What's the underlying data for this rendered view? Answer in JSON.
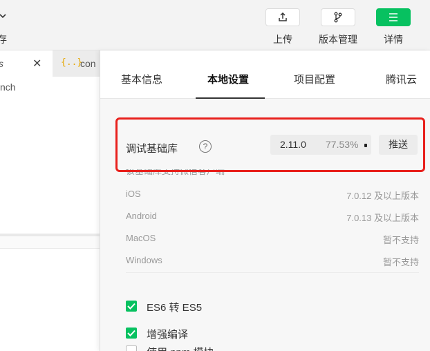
{
  "toolbar": {
    "left_partial_label": "存",
    "buttons": [
      {
        "label": "上传",
        "icon": "upload-icon"
      },
      {
        "label": "版本管理",
        "icon": "branch-icon"
      },
      {
        "label": "详情",
        "icon": "menu-icon"
      }
    ]
  },
  "editor": {
    "tabs": [
      {
        "label": "s",
        "active": true
      },
      {
        "label": "con",
        "icon": "{..}"
      }
    ],
    "partial_text": "nch"
  },
  "panel": {
    "tabs": [
      "基本信息",
      "本地设置",
      "项目配置",
      "腾讯云"
    ],
    "active_tab": "本地设置",
    "debug_lib": {
      "label": "调试基础库",
      "version": "2.11.0",
      "percent": "77.53%",
      "push_label": "推送",
      "note": "该基础库支持微信客户端"
    },
    "platforms": [
      {
        "name": "iOS",
        "support": "7.0.12 及以上版本"
      },
      {
        "name": "Android",
        "support": "7.0.13 及以上版本"
      },
      {
        "name": "MacOS",
        "support": "暂不支持"
      },
      {
        "name": "Windows",
        "support": "暂不支持"
      }
    ],
    "options": [
      {
        "label": "ES6 转 ES5",
        "checked": true
      },
      {
        "label": "增强编译",
        "checked": true
      },
      {
        "label": "使用 npm 模块",
        "checked": false
      }
    ]
  },
  "colors": {
    "accent_green": "#07c160",
    "highlight_red": "#e8201c"
  }
}
